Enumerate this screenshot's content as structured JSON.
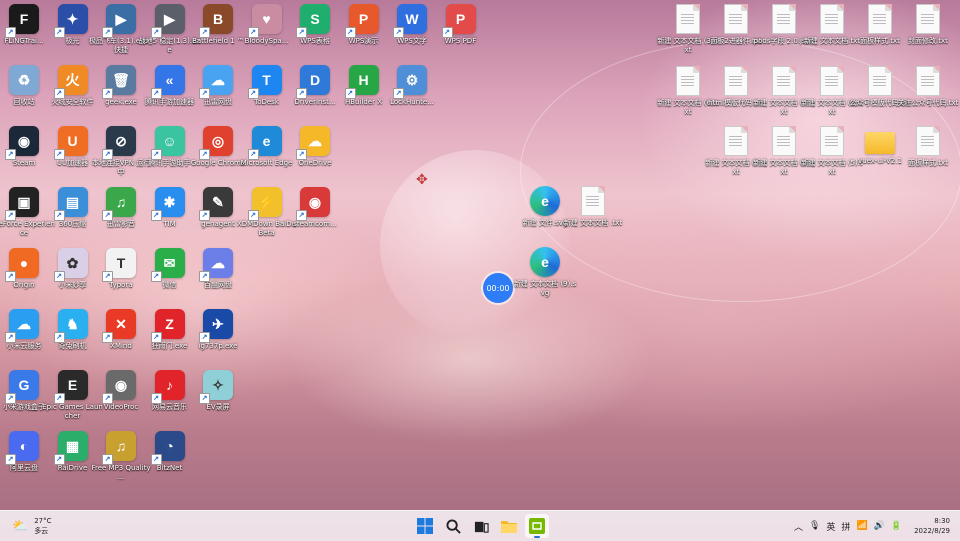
{
  "desktop": {
    "left_icons": [
      {
        "label": "FLiNGTrai...",
        "icon": "fling-trainer-icon",
        "color": "#1a1a1a",
        "glyph": "F",
        "shortcut": true
      },
      {
        "label": "极光",
        "icon": "aurora-icon",
        "color": "#2b4fa8",
        "glyph": "✦",
        "shortcut": true
      },
      {
        "label": "极品飞车(3.1).exe - 快捷",
        "icon": "game-icon",
        "color": "#3a6ea5",
        "glyph": "▶",
        "shortcut": true
      },
      {
        "label": "战地5 稳定(1.3).exe",
        "icon": "game-icon",
        "color": "#5a5f6a",
        "glyph": "▶",
        "shortcut": true
      },
      {
        "label": "Battlefield 1 ™",
        "icon": "battlefield-icon",
        "color": "#8a4a2a",
        "glyph": "B",
        "shortcut": true
      },
      {
        "label": "BloodySpa...",
        "icon": "anime-icon",
        "color": "#c98ca0",
        "glyph": "♥",
        "shortcut": true
      },
      {
        "label": "WPS表格",
        "icon": "wps-sheet-icon",
        "color": "#1fae6e",
        "glyph": "S",
        "shortcut": true
      },
      {
        "label": "WPS演示",
        "icon": "wps-present-icon",
        "color": "#e8582d",
        "glyph": "P",
        "shortcut": true
      },
      {
        "label": "WPS文字",
        "icon": "wps-writer-icon",
        "color": "#2f6fe0",
        "glyph": "W",
        "shortcut": true
      },
      {
        "label": "WPS PDF",
        "icon": "wps-pdf-icon",
        "color": "#e34a4a",
        "glyph": "P",
        "shortcut": true
      },
      {
        "label": "回收站",
        "icon": "recycle-bin-icon",
        "color": "#7fa8d4",
        "glyph": "♻",
        "shortcut": false
      },
      {
        "label": "火绒安全软件",
        "icon": "huorong-icon",
        "color": "#f08a24",
        "glyph": "火",
        "shortcut": true
      },
      {
        "label": "geek.exe",
        "icon": "geek-icon",
        "color": "#5a7aa0",
        "glyph": "🗑",
        "shortcut": true
      },
      {
        "label": "腾讯手游加速器",
        "icon": "tencent-accel-icon",
        "color": "#3475e8",
        "glyph": "«",
        "shortcut": true
      },
      {
        "label": "迅雷网盘",
        "icon": "cloud-drive-icon",
        "color": "#4aa3f0",
        "glyph": "☁",
        "shortcut": true
      },
      {
        "label": "ToDesk",
        "icon": "todesk-icon",
        "color": "#1e86f0",
        "glyph": "T",
        "shortcut": true
      },
      {
        "label": "DriverInst...",
        "icon": "driver-icon",
        "color": "#2f7ad8",
        "glyph": "D",
        "shortcut": true
      },
      {
        "label": "HBuilder X",
        "icon": "hbuilder-icon",
        "color": "#27a645",
        "glyph": "H",
        "shortcut": true
      },
      {
        "label": "LockHunte...",
        "icon": "lockhunter-icon",
        "color": "#4f8fd8",
        "glyph": "⚙",
        "shortcut": true
      },
      {
        "label": "Steam",
        "icon": "steam-icon",
        "color": "#1b2838",
        "glyph": "◉",
        "shortcut": true
      },
      {
        "label": "UU加速器",
        "icon": "uu-icon",
        "color": "#f06e24",
        "glyph": "U",
        "shortcut": true
      },
      {
        "label": "本地连接VPN 运行中",
        "icon": "vpn-icon",
        "color": "#2a3a4a",
        "glyph": "⊘",
        "shortcut": true
      },
      {
        "label": "腾讯手游助手",
        "icon": "tencent-helper-icon",
        "color": "#3bc4a0",
        "glyph": "☺",
        "shortcut": true
      },
      {
        "label": "Google Chrome",
        "icon": "chrome-icon",
        "color": "#e0412f",
        "glyph": "◎",
        "shortcut": true
      },
      {
        "label": "Microsoft Edge",
        "icon": "edge-icon",
        "color": "#1f8ad8",
        "glyph": "e",
        "shortcut": true
      },
      {
        "label": "OneDrive",
        "icon": "onedrive-icon",
        "color": "#f5b829",
        "glyph": "☁",
        "shortcut": true
      },
      {
        "label": "GeForce Experience",
        "icon": "geforce-icon",
        "color": "#222222",
        "glyph": "▣",
        "shortcut": true
      },
      {
        "label": "360压缩",
        "icon": "360zip-icon",
        "color": "#3a8fd8",
        "glyph": "▤",
        "shortcut": true
      },
      {
        "label": "迅雷影音",
        "icon": "xunlei-icon",
        "color": "#3aa84a",
        "glyph": "♫",
        "shortcut": true
      },
      {
        "label": "TIM",
        "icon": "tim-icon",
        "color": "#2a8ef0",
        "glyph": "✱",
        "shortcut": true
      },
      {
        "label": "genagent",
        "icon": "genagent-icon",
        "color": "#3a3a3a",
        "glyph": "✎",
        "shortcut": true
      },
      {
        "label": "XDMDown BaiDu Beta",
        "icon": "xdm-icon",
        "color": "#f2c02a",
        "glyph": "⚡",
        "shortcut": true
      },
      {
        "label": "steamcom...",
        "icon": "steamcommunity-icon",
        "color": "#d83a3a",
        "glyph": "◉",
        "shortcut": true
      },
      {
        "label": "Origin",
        "icon": "origin-icon",
        "color": "#f06a24",
        "glyph": "●",
        "shortcut": true
      },
      {
        "label": "小米妙享",
        "icon": "miui-share-icon",
        "color": "#d9d0e8",
        "glyph": "✿",
        "shortcut": true
      },
      {
        "label": "Typora",
        "icon": "typora-icon",
        "color": "#f2f2f2",
        "glyph": "T",
        "shortcut": true
      },
      {
        "label": "微信",
        "icon": "wechat-icon",
        "color": "#2aae4a",
        "glyph": "✉",
        "shortcut": true
      },
      {
        "label": "百度网盘",
        "icon": "baidu-drive-icon",
        "color": "#6c7ee8",
        "glyph": "☁",
        "shortcut": true
      },
      {
        "label": "小米云服务",
        "icon": "mi-cloud-icon",
        "color": "#2a9ef0",
        "glyph": "☁",
        "shortcut": true
      },
      {
        "label": "奇兔刷机",
        "icon": "qitu-icon",
        "color": "#2ab0f0",
        "glyph": "♞",
        "shortcut": true
      },
      {
        "label": "XMind",
        "icon": "xmind-icon",
        "color": "#e83a24",
        "glyph": "✕",
        "shortcut": true
      },
      {
        "label": "狂雨门.exe",
        "icon": "zapp-icon",
        "color": "#e0242a",
        "glyph": "Z",
        "shortcut": true
      },
      {
        "label": "ig737p.exe",
        "icon": "ig-icon",
        "color": "#1a4aa8",
        "glyph": "✈",
        "shortcut": true
      },
      {
        "label": "小米游戏盒子",
        "icon": "mi-gamebox-icon",
        "color": "#3a7ae8",
        "glyph": "G",
        "shortcut": true
      },
      {
        "label": "Epic Games Launcher",
        "icon": "epic-icon",
        "color": "#2a2a2a",
        "glyph": "E",
        "shortcut": true
      },
      {
        "label": "VideoProc",
        "icon": "videoproc-icon",
        "color": "#6a6a6a",
        "glyph": "◉",
        "shortcut": true
      },
      {
        "label": "网易云音乐",
        "icon": "netease-music-icon",
        "color": "#e0242a",
        "glyph": "♪",
        "shortcut": true
      },
      {
        "label": "EV录屏",
        "icon": "ev-record-icon",
        "color": "#8fd0d8",
        "glyph": "✧",
        "shortcut": true
      },
      {
        "label": "阿里云盘",
        "icon": "aliyun-drive-icon",
        "color": "#4a6af0",
        "glyph": "◐",
        "shortcut": true
      },
      {
        "label": "RaiDrive",
        "icon": "raidrive-icon",
        "color": "#2aae6a",
        "glyph": "▦",
        "shortcut": true
      },
      {
        "label": "Free MP3 Quality ...",
        "icon": "mp3-icon",
        "color": "#c8a030",
        "glyph": "♫",
        "shortcut": true
      },
      {
        "label": "BitzNet",
        "icon": "bitznet-icon",
        "color": "#2a4a8a",
        "glyph": "◔",
        "shortcut": true
      }
    ],
    "right_icons": [
      {
        "label": "新建 文本文档 (3).txt",
        "icon": "text-file-icon",
        "type": "file"
      },
      {
        "label": "面板2进器件.txt",
        "icon": "text-file-icon",
        "type": "file"
      },
      {
        "label": "pods字段 2.0.json",
        "icon": "text-file-icon",
        "type": "file"
      },
      {
        "label": "新建 文本文档.txt",
        "icon": "text-file-icon",
        "type": "file"
      },
      {
        "label": "面板样式.txt",
        "icon": "text-file-icon",
        "type": "file"
      },
      {
        "label": "封面修改.txt",
        "icon": "text-file-icon",
        "type": "file"
      },
      {
        "label": "新建 文本文档 (6).txt",
        "icon": "text-file-icon",
        "type": "file"
      },
      {
        "label": "html模版代码.txt",
        "icon": "text-file-icon",
        "type": "file"
      },
      {
        "label": "新建 文本文档 (4).txt",
        "icon": "text-file-icon",
        "type": "file"
      },
      {
        "label": "新建 文本文档 (2).txt",
        "icon": "text-file-icon",
        "type": "file"
      },
      {
        "label": "公众号模版代码.txt",
        "icon": "text-file-icon",
        "type": "file"
      },
      {
        "label": "关注公众号代码.txt",
        "icon": "text-file-icon",
        "type": "file"
      },
      {
        "label": "新建 文本文档 (7).txt",
        "icon": "text-file-icon",
        "type": "file"
      },
      {
        "label": "新建 文本文档 (8).txt",
        "icon": "text-file-icon",
        "type": "file"
      },
      {
        "label": "新建 文本文档 (5).txt",
        "icon": "text-file-icon",
        "type": "file"
      },
      {
        "label": "vuex-ui-V2.1",
        "icon": "folder-icon",
        "type": "folder"
      },
      {
        "label": "面板样式.txt",
        "icon": "text-file-icon",
        "type": "file"
      }
    ],
    "center_icons": [
      {
        "label": "新建 文件.svg",
        "icon": "edge-svg-icon",
        "type": "edge"
      },
      {
        "label": "新建 文本文档 .txt",
        "icon": "text-file-icon",
        "type": "file"
      },
      {
        "label": "新建 文本文档 (9).svg",
        "icon": "edge-svg-icon",
        "type": "edge"
      }
    ],
    "timer_widget": "00:00"
  },
  "taskbar": {
    "weather_temp": "27°C",
    "weather_desc": "多云",
    "tray_ime_lang": "英",
    "tray_ime_mode": "拼",
    "clock_time": "8:30",
    "clock_date": "2022/8/29"
  }
}
